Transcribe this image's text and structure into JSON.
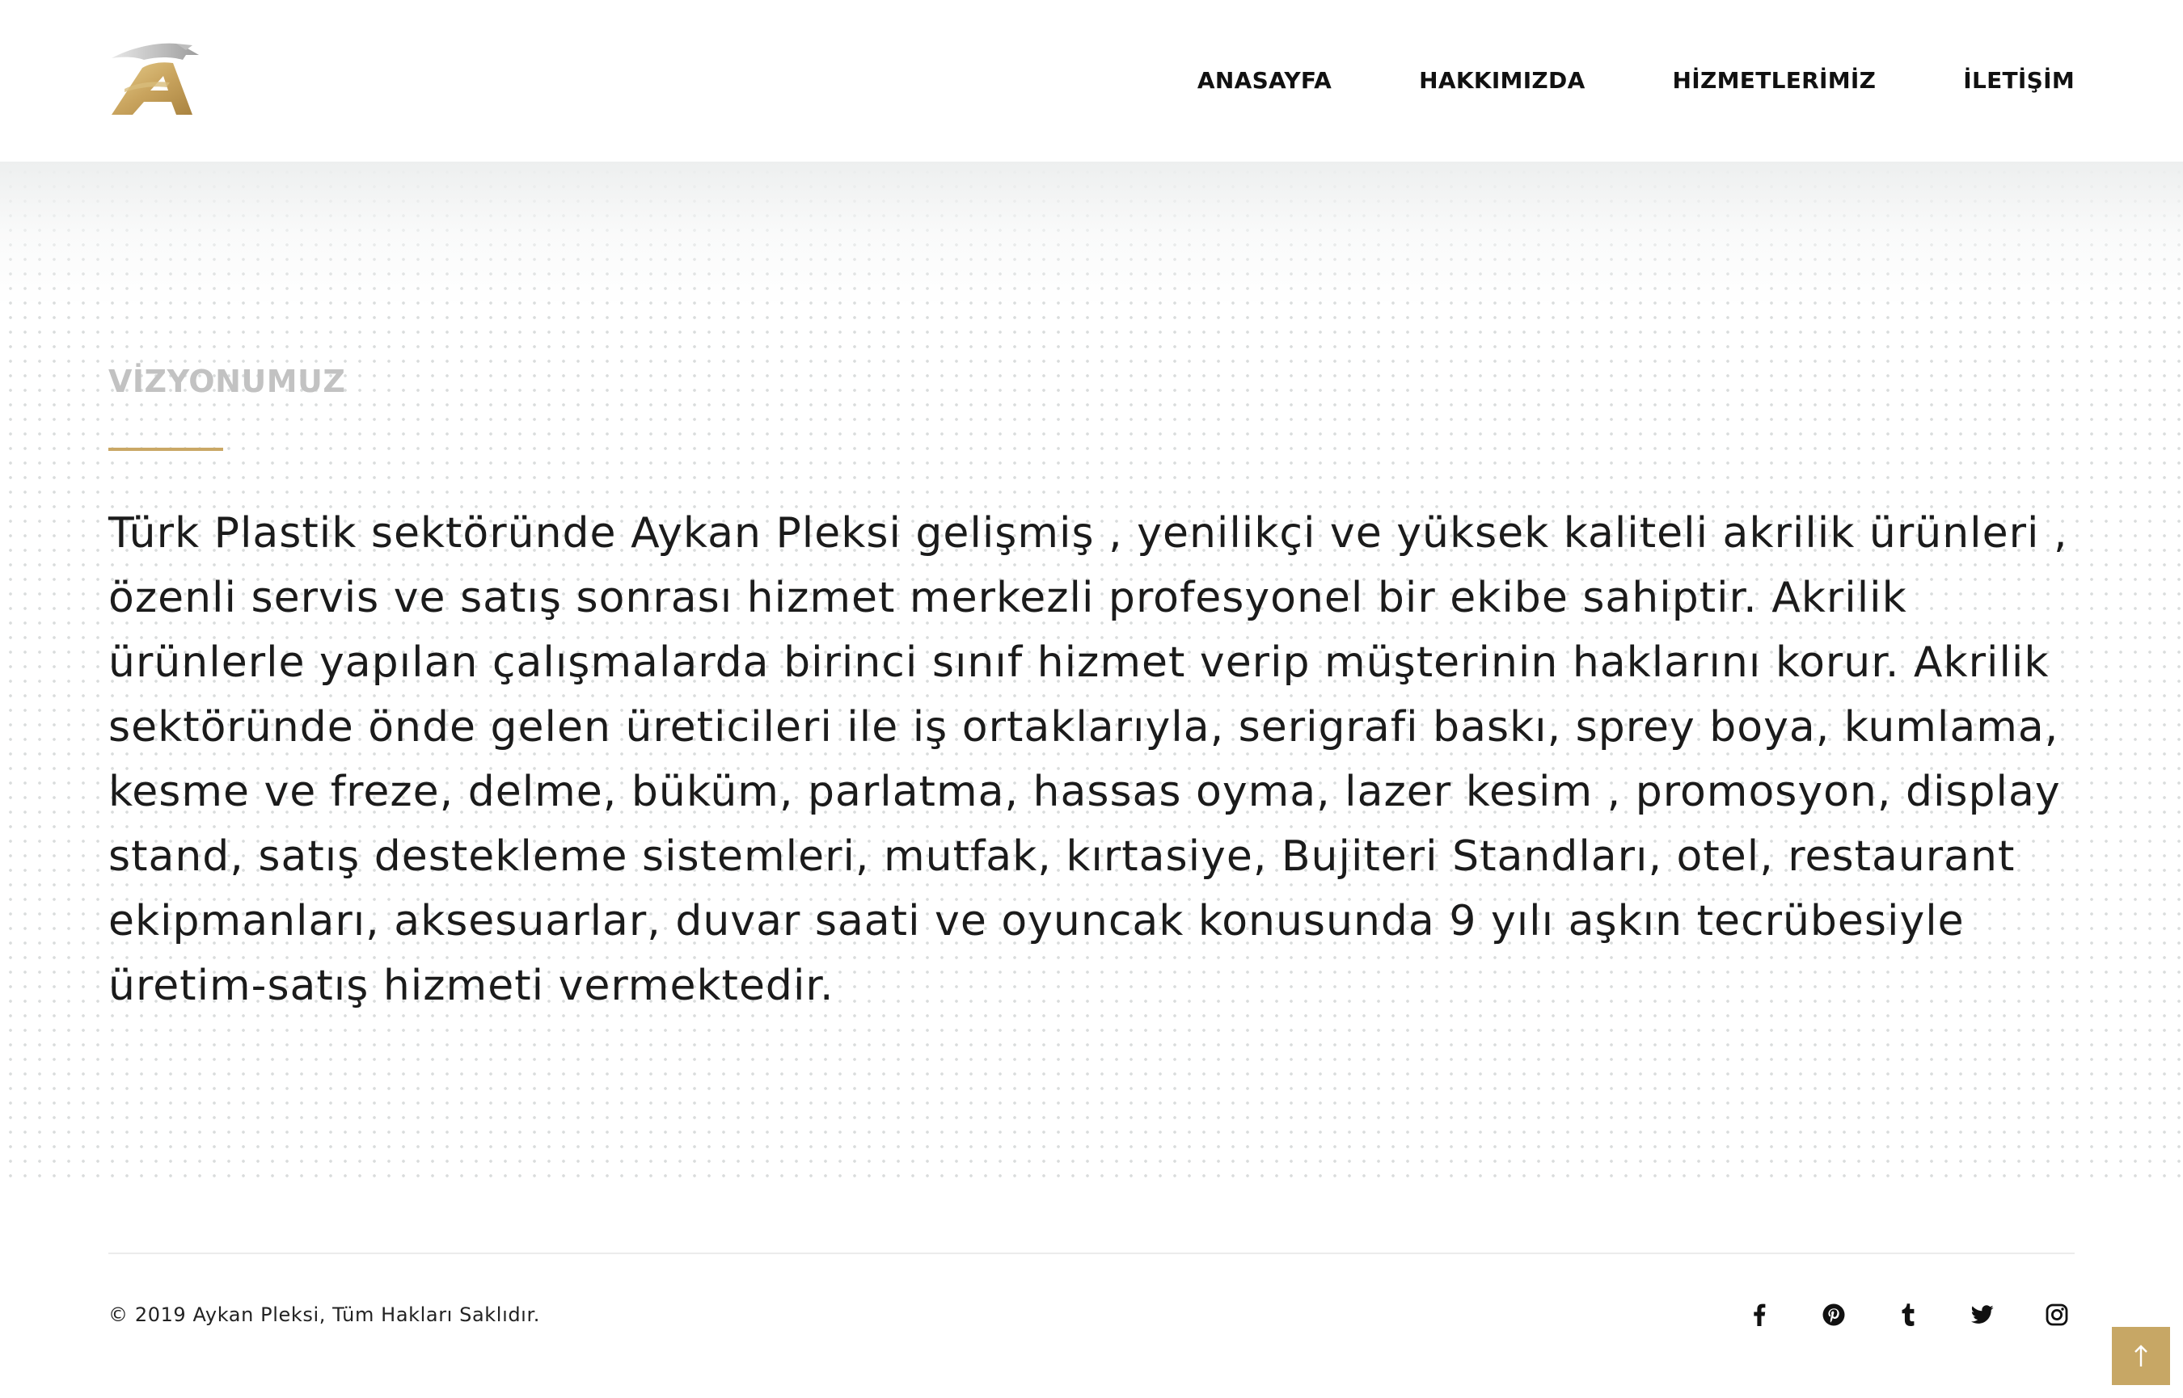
{
  "header": {
    "logo_alt": "Aykan Pleksi",
    "nav": [
      {
        "label": "ANASAYFA"
      },
      {
        "label": "HAKKIMIZDA"
      },
      {
        "label": "HİZMETLERİMİZ"
      },
      {
        "label": "İLETİŞİM"
      }
    ]
  },
  "section": {
    "title": "VİZYONUMUZ",
    "body": "Türk Plastik sektöründe Aykan Pleksi gelişmiş , yenilikçi ve yüksek kaliteli akrilik ürünleri , özenli servis ve satış sonrası hizmet merkezli profesyonel bir ekibe sahiptir. Akrilik ürünlerle yapılan çalışmalarda birinci sınıf hizmet verip müşterinin haklarını korur. Akrilik sektöründe önde gelen üreticileri ile iş ortaklarıyla, serigrafi baskı, sprey boya, kumlama, kesme ve freze, delme, büküm, parlatma, hassas oyma, lazer kesim , promosyon, display stand, satış destekleme sistemleri, mutfak, kırtasiye, Bujiteri Standları, otel, restaurant ekipmanları, aksesuarlar, duvar saati ve oyuncak konusunda 9 yılı aşkın tecrübesiyle üretim-satış hizmeti vermektedir."
  },
  "footer": {
    "copyright": "© 2019 Aykan Pleksi, Tüm Hakları Saklıdır.",
    "social": [
      {
        "icon": "facebook-icon"
      },
      {
        "icon": "pinterest-icon"
      },
      {
        "icon": "tumblr-icon"
      },
      {
        "icon": "twitter-icon"
      },
      {
        "icon": "instagram-icon"
      }
    ]
  },
  "colors": {
    "accent": "#caa866",
    "back_to_top": "#c7a765",
    "title_grey": "#c2c2c2",
    "text": "#1b1b1b"
  },
  "back_to_top": {
    "icon": "arrow-up-icon"
  }
}
